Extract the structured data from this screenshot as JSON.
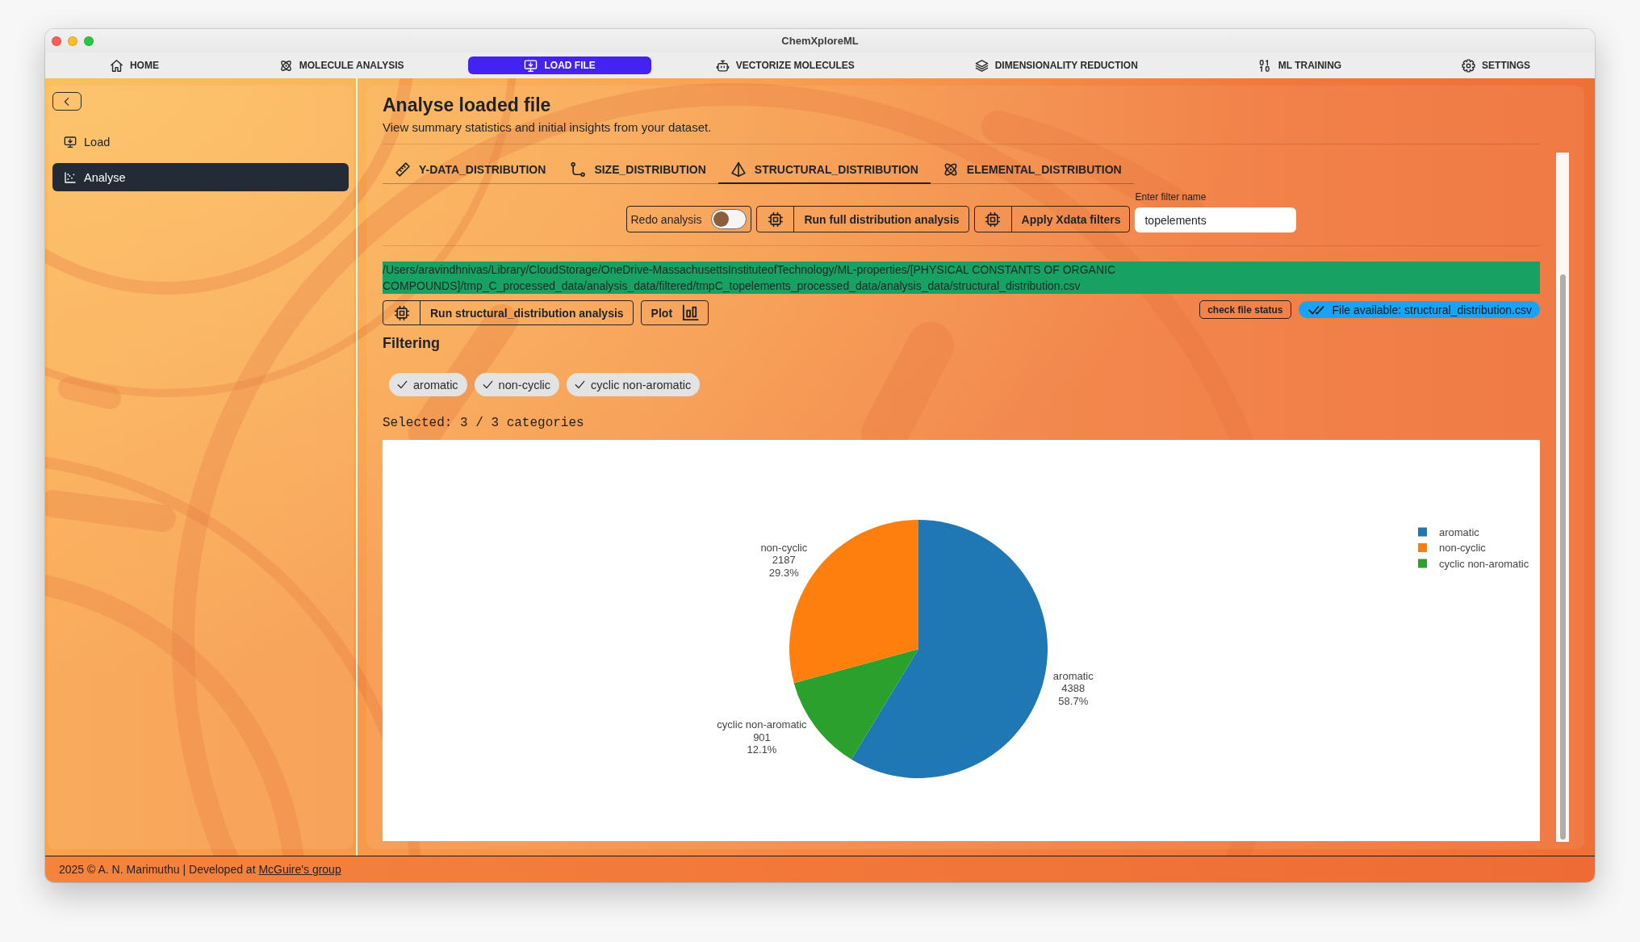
{
  "window": {
    "title": "ChemXploreML"
  },
  "nav": [
    {
      "label": "HOME",
      "kind": "home",
      "selected": false
    },
    {
      "label": "MOLECULE ANALYSIS",
      "kind": "atom",
      "selected": false
    },
    {
      "label": "LOAD FILE",
      "kind": "monitor",
      "selected": true
    },
    {
      "label": "VECTORIZE MOLECULES",
      "kind": "robot",
      "selected": false
    },
    {
      "label": "DIMENSIONALITY REDUCTION",
      "kind": "layers",
      "selected": false
    },
    {
      "label": "ML TRAINING",
      "kind": "binary",
      "selected": false
    },
    {
      "label": "SETTINGS",
      "kind": "gear",
      "selected": false
    }
  ],
  "sidebar": {
    "items": [
      {
        "label": "Load",
        "kind": "monitor",
        "selected": false
      },
      {
        "label": "Analyse",
        "kind": "scatter",
        "selected": true
      }
    ]
  },
  "header": {
    "title": "Analyse loaded file",
    "subtitle": "View summary statistics and initial insights from your dataset."
  },
  "tabs": [
    {
      "label": "Y-DATA_DISTRIBUTION",
      "kind": "ruler",
      "selected": false
    },
    {
      "label": "SIZE_DISTRIBUTION",
      "kind": "nodes",
      "selected": false
    },
    {
      "label": "STRUCTURAL_DISTRIBUTION",
      "kind": "pyramid",
      "selected": true
    },
    {
      "label": "ELEMENTAL_DISTRIBUTION",
      "kind": "atom",
      "selected": false
    }
  ],
  "toolbar": {
    "redo": {
      "label": "Redo analysis",
      "on": false
    },
    "buttons": [
      {
        "label": "Run full distribution analysis"
      },
      {
        "label": "Apply Xdata filters"
      }
    ],
    "filter": {
      "label": "Enter filter name",
      "value": "topelements"
    }
  },
  "file_path": "/Users/aravindhnivas/Library/CloudStorage/OneDrive-MassachusettsInstituteofTechnology/ML-properties/[PHYSICAL CONSTANTS OF ORGANIC COMPOUNDS]/tmp_C_processed_data/analysis_data/filtered/tmpC_topelements_processed_data/analysis_data/structural_distribution.csv",
  "actions": {
    "run_button": "Run structural_distribution analysis",
    "plot_button": "Plot",
    "check_button": "check file status",
    "status": {
      "label": "File available: structural_distribution.csv",
      "available": true
    }
  },
  "filtering": {
    "title": "Filtering",
    "chips": [
      {
        "label": "aromatic",
        "selected": true
      },
      {
        "label": "non-cyclic",
        "selected": true
      },
      {
        "label": "cyclic non-aromatic",
        "selected": true
      }
    ],
    "summary": "Selected: 3 / 3 categories"
  },
  "chart": {
    "chart_data": {
      "type": "pie",
      "categories": [
        "aromatic",
        "cyclic non-aromatic",
        "non-cyclic"
      ],
      "values": [
        4388,
        901,
        2187
      ],
      "colors": [
        "#1f77b4",
        "#2ca02c",
        "#ff7f0e"
      ],
      "value_labels": [
        "4388",
        "901",
        "2187"
      ]
    },
    "percent_labels": [
      "58.7%",
      "12.1%",
      "29.3%"
    ],
    "legend": [
      {
        "label": "aromatic",
        "color": "#1f77b4"
      },
      {
        "label": "non-cyclic",
        "color": "#ff7f0e"
      },
      {
        "label": "cyclic non-aromatic",
        "color": "#2ca02c"
      }
    ]
  },
  "footer": {
    "text": "2025 © A. N. Marimuthu | Developed at ",
    "link": "McGuire's group"
  }
}
